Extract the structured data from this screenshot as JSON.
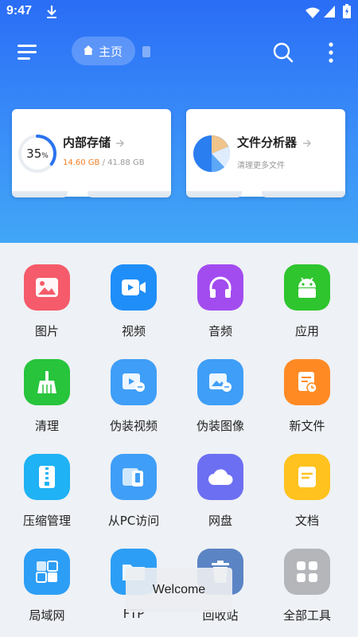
{
  "status_bar": {
    "time": "9:47",
    "icons": [
      "download-icon",
      "wifi-icon",
      "signal-icon",
      "battery-charging-icon"
    ]
  },
  "app_bar": {
    "home_label": "主页",
    "menu_icon": "hamburger-menu-icon",
    "search_icon": "search-icon",
    "more_icon": "more-vert-icon"
  },
  "storage_card": {
    "title": "内部存储",
    "percent": "35",
    "percent_sign": "%",
    "used": "14.60 GB",
    "separator": " / ",
    "total": "41.88 GB",
    "used_fraction": 0.35
  },
  "analyzer_card": {
    "title": "文件分析器",
    "subtitle": "清理更多文件"
  },
  "tiles": [
    {
      "label": "图片",
      "icon": "image-icon",
      "color": "#f55b6a"
    },
    {
      "label": "视频",
      "icon": "video-icon",
      "color": "#1f8ef8"
    },
    {
      "label": "音频",
      "icon": "headphones-icon",
      "color": "#a24cf0"
    },
    {
      "label": "应用",
      "icon": "android-icon",
      "color": "#2ec52e"
    },
    {
      "label": "清理",
      "icon": "broom-icon",
      "color": "#27c43c"
    },
    {
      "label": "伪装视频",
      "icon": "disguise-video-icon",
      "color": "#3f9ef7"
    },
    {
      "label": "伪装图像",
      "icon": "disguise-image-icon",
      "color": "#3f9ef7"
    },
    {
      "label": "新文件",
      "icon": "new-file-icon",
      "color": "#ff8a24"
    },
    {
      "label": "压缩管理",
      "icon": "zip-icon",
      "color": "#1fb2f4"
    },
    {
      "label": "从PC访问",
      "icon": "pc-access-icon",
      "color": "#3f9ef7"
    },
    {
      "label": "网盘",
      "icon": "cloud-icon",
      "color": "#6d6ff2"
    },
    {
      "label": "文档",
      "icon": "document-icon",
      "color": "#ffc21e"
    },
    {
      "label": "局域网",
      "icon": "lan-icon",
      "color": "#2d9ef5"
    },
    {
      "label": "FTP",
      "icon": "ftp-icon",
      "color": "#2d9ef5"
    },
    {
      "label": "回收站",
      "icon": "trash-icon",
      "color": "#5b84c4"
    },
    {
      "label": "全部工具",
      "icon": "all-tools-icon",
      "color": "#b4b6ba"
    }
  ],
  "toast": {
    "text": "Welcome"
  }
}
